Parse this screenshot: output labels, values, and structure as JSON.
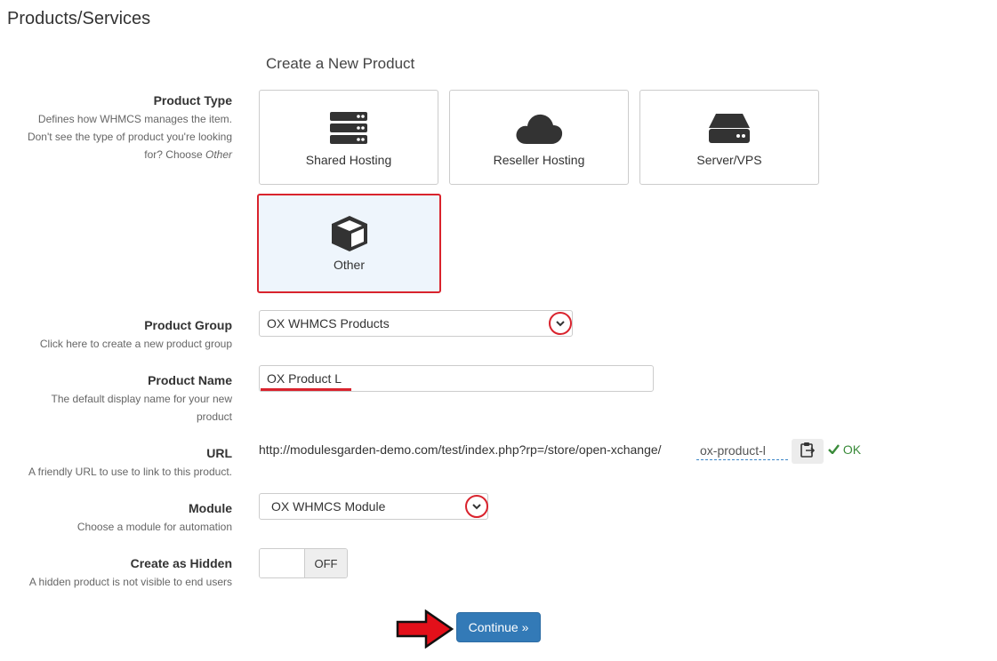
{
  "page": {
    "title": "Products/Services"
  },
  "form": {
    "heading": "Create a New Product",
    "product_type": {
      "label": "Product Type",
      "help_line1": "Defines how WHMCS manages the item.",
      "help_line2": "Don't see the type of product you're looking",
      "help_line3_prefix": "for? Choose ",
      "help_line3_em": "Other",
      "options": [
        {
          "label": "Shared Hosting",
          "icon": "server-stack-icon",
          "selected": false
        },
        {
          "label": "Reseller Hosting",
          "icon": "cloud-icon",
          "selected": false
        },
        {
          "label": "Server/VPS",
          "icon": "hard-drive-icon",
          "selected": false
        },
        {
          "label": "Other",
          "icon": "cube-icon",
          "selected": true
        }
      ]
    },
    "product_group": {
      "label": "Product Group",
      "help": "Click here to create a new product group",
      "value": "OX WHMCS Products"
    },
    "product_name": {
      "label": "Product Name",
      "help_line1": "The default display name for your new",
      "help_line2": "product",
      "value": "OX Product L"
    },
    "url": {
      "label": "URL",
      "help": "A friendly URL to use to link to this product.",
      "base": "http://modulesgarden-demo.com/test/index.php?rp=/store/open-xchange/",
      "slug": "ox-product-l",
      "status": "OK"
    },
    "module": {
      "label": "Module",
      "help": "Choose a module for automation",
      "value": "OX WHMCS Module"
    },
    "hidden": {
      "label": "Create as Hidden",
      "help": "A hidden product is not visible to end users",
      "state": "OFF"
    },
    "continue_label": "Continue »"
  },
  "colors": {
    "accent_blue": "#337ab7",
    "highlight_red": "#d9232d",
    "ok_green": "#3a8b3a",
    "selected_bg": "#eef5fc"
  }
}
